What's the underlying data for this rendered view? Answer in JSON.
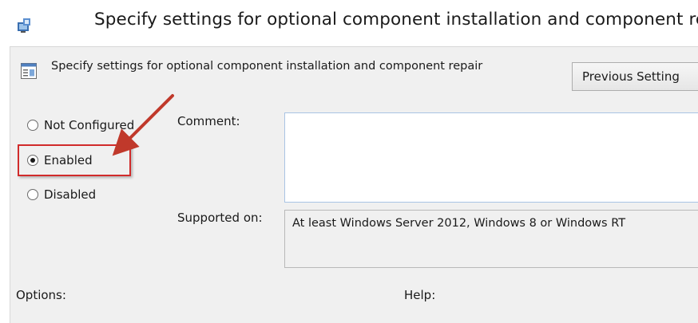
{
  "window": {
    "title": "Specify settings for optional component installation and component repair",
    "icon": "group-policy-icon"
  },
  "header": {
    "policy_name": "Specify settings for optional component installation and component repair",
    "icon": "policy-setting-icon",
    "previous_button_label": "Previous Setting"
  },
  "state": {
    "options": [
      {
        "label": "Not Configured",
        "selected": false
      },
      {
        "label": "Enabled",
        "selected": true
      },
      {
        "label": "Disabled",
        "selected": false
      }
    ]
  },
  "comment": {
    "label": "Comment:",
    "value": ""
  },
  "supported": {
    "label": "Supported on:",
    "value": "At least Windows Server 2012, Windows 8 or Windows RT"
  },
  "sections": {
    "options_label": "Options:",
    "help_label": "Help:"
  },
  "annotation": {
    "highlight_color": "#d12b2b",
    "arrow_color": "#c0392b"
  }
}
